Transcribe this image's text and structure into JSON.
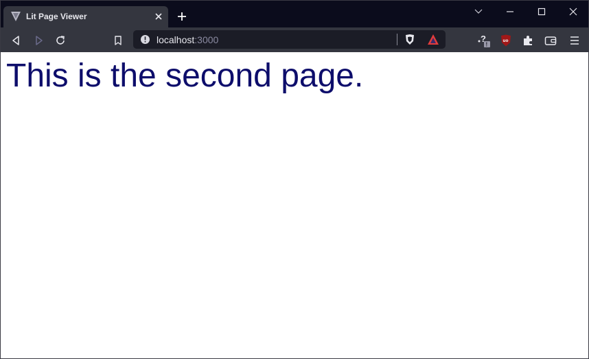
{
  "browser": {
    "tab": {
      "title": "Lit Page Viewer",
      "favicon": "lit-logo-icon"
    },
    "address_bar": {
      "host": "localhost",
      "port": ":3000"
    },
    "extensions": [
      "help-extension-icon",
      "ublock-icon",
      "puzzle-extensions-icon",
      "wallet-icon"
    ],
    "accent_color": "#0b0c1c",
    "toolbar_color": "#34363f"
  },
  "page": {
    "heading": "This is the second page.",
    "heading_color": "#0d0d6b"
  }
}
